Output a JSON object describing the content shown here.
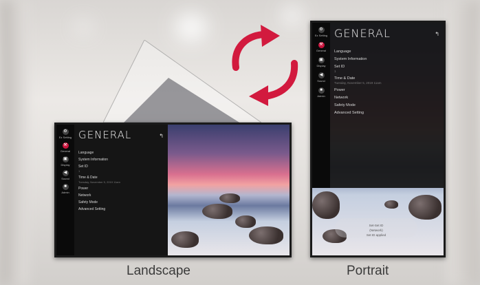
{
  "colors": {
    "accent": "#c8143c",
    "arrow": "#d21a3e"
  },
  "captions": {
    "landscape": "Landscape",
    "portrait": "Portrait"
  },
  "rail": [
    {
      "icon": "quick-settings-icon",
      "label": "Ez Setting"
    },
    {
      "icon": "general-icon",
      "label": "General",
      "active": true
    },
    {
      "icon": "picture-icon",
      "label": "Display"
    },
    {
      "icon": "sound-icon",
      "label": "Sound"
    },
    {
      "icon": "lock-icon",
      "label": "Admin"
    }
  ],
  "menu": {
    "title": "GENERAL",
    "back_symbol": "↰",
    "items": [
      {
        "label": "Language"
      },
      {
        "label": "System Information"
      },
      {
        "label": "Set ID",
        "sub": "1"
      },
      {
        "label": "Time & Date",
        "sub": "Tuesday, November 5, 2019 11am"
      },
      {
        "label": "Power"
      },
      {
        "label": "Network"
      },
      {
        "label": "Safety Mode"
      },
      {
        "label": "Advanced Setting"
      }
    ]
  },
  "toast": {
    "line1": "Set-Set ID",
    "line2": "(Network)",
    "line3": "Set ID applied"
  }
}
